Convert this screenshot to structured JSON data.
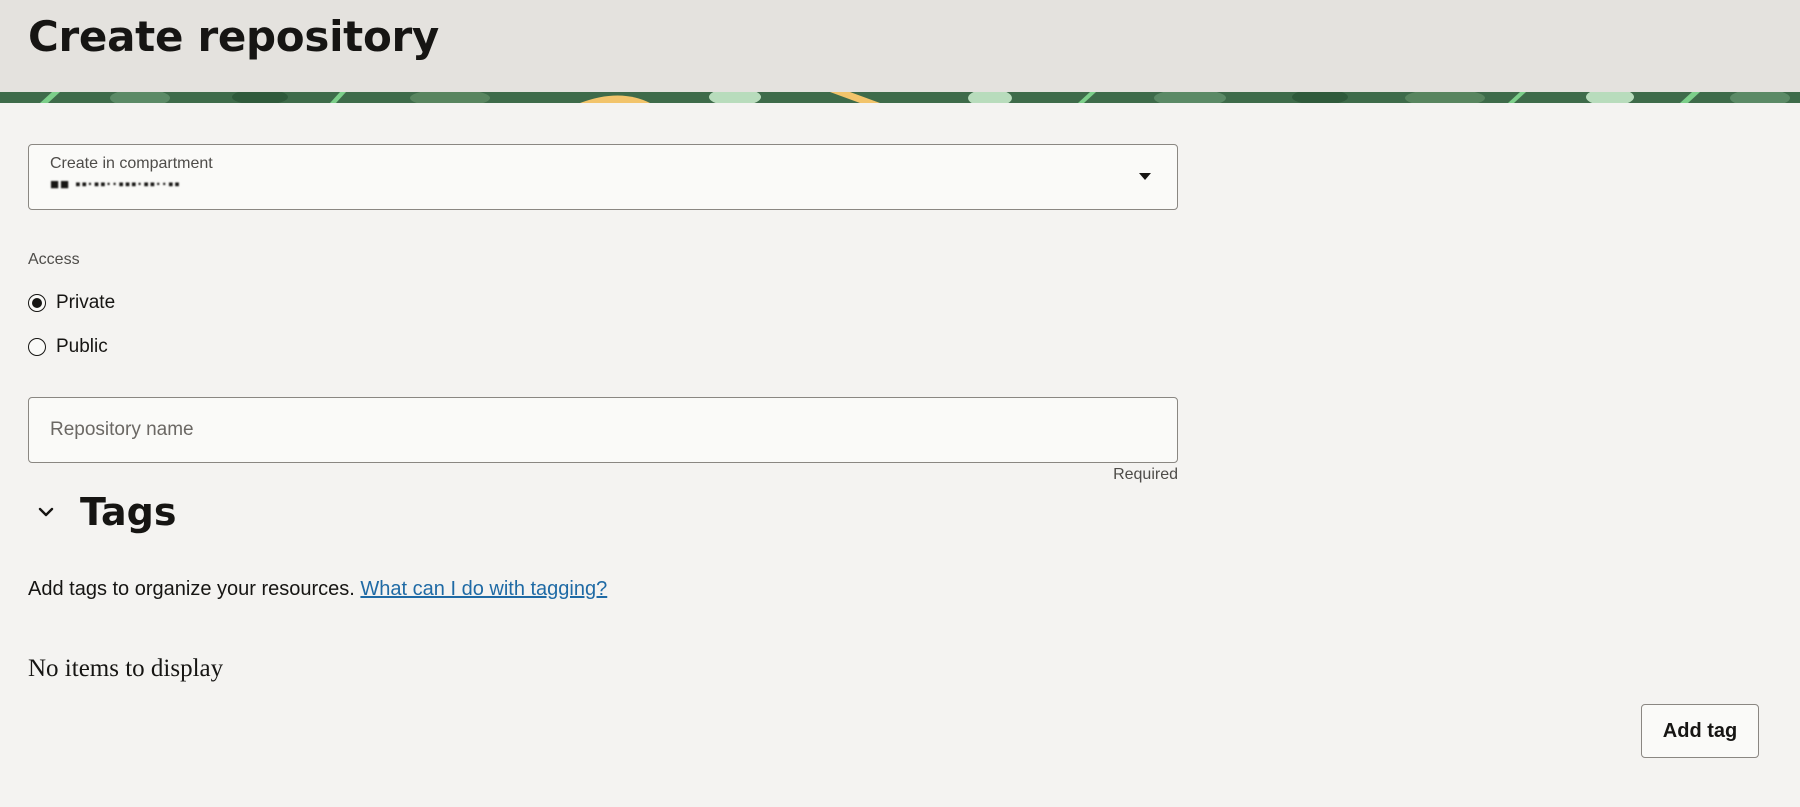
{
  "header": {
    "title": "Create repository"
  },
  "compartment": {
    "label": "Create in compartment",
    "value": "■■ ▪▪·▪▪··▪▪▪·▪▪··▪▪"
  },
  "access": {
    "label": "Access",
    "options": [
      {
        "label": "Private",
        "selected": true
      },
      {
        "label": "Public",
        "selected": false
      }
    ]
  },
  "repository_name": {
    "placeholder": "Repository name",
    "value": "",
    "helper": "Required"
  },
  "tags": {
    "title": "Tags",
    "description": "Add tags to organize your resources.",
    "link": "What can I do with tagging?",
    "empty_message": "No items to display",
    "add_button": "Add tag"
  },
  "colors": {
    "header_bg": "#e4e2de",
    "page_bg": "#f4f3f1",
    "link": "#1f6aa5",
    "banner_green": "#3e6b4a",
    "banner_accent": "#f2c46b"
  }
}
